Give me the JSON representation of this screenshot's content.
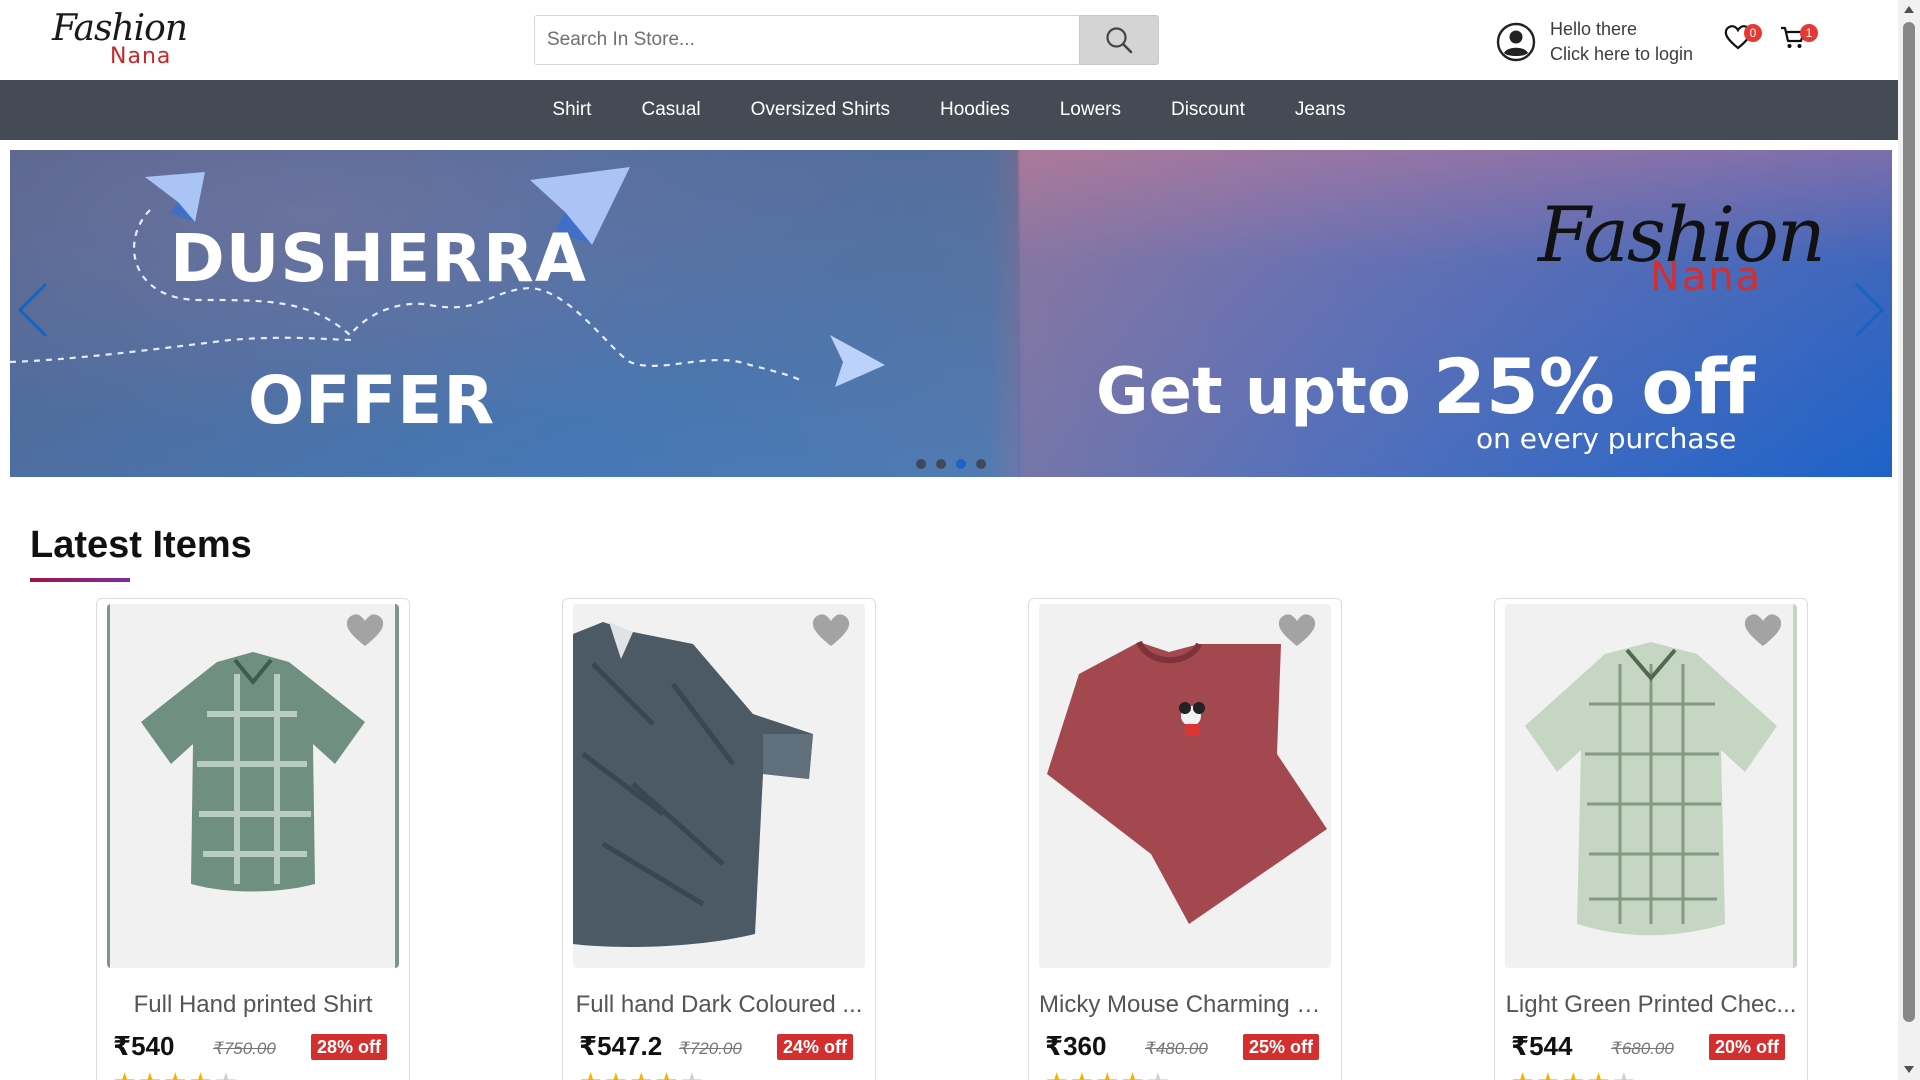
{
  "header": {
    "logo_main": "Fashion",
    "logo_sub": "Nana",
    "search_placeholder": "Search In Store...",
    "greeting": "Hello there",
    "login_prompt": "Click here to login",
    "wishlist_count": "0",
    "cart_count": "1"
  },
  "nav": {
    "items": [
      "Shirt",
      "Casual",
      "Oversized Shirts",
      "Hoodies",
      "Lowers",
      "Discount",
      "Jeans"
    ]
  },
  "banner": {
    "headline_1": "DUSHERRA",
    "headline_2": "OFFER",
    "logo_main": "Fashion",
    "logo_sub": "Nana",
    "offer_prefix": "Get upto",
    "offer_value": "25% off",
    "offer_sub": "on every purchase",
    "slide_count": 4,
    "active_slide": 3
  },
  "section": {
    "title": "Latest Items"
  },
  "products": [
    {
      "name": "Full Hand printed Shirt",
      "price": "₹540",
      "mrp": "₹750.00",
      "discount": "28% off",
      "rating": 4,
      "image_color": "#6f8f80"
    },
    {
      "name": "Full hand Dark Coloured ...",
      "price": "₹547.2",
      "mrp": "₹720.00",
      "discount": "24% off",
      "rating": 4,
      "image_color": "#4c5a66"
    },
    {
      "name": "Micky Mouse Charming C...",
      "price": "₹360",
      "mrp": "₹480.00",
      "discount": "25% off",
      "rating": 4,
      "image_color": "#a4484f"
    },
    {
      "name": "Light Green Printed Chec...",
      "price": "₹544",
      "mrp": "₹680.00",
      "discount": "20% off",
      "rating": 4,
      "image_color": "#c5d6c3"
    }
  ],
  "colors": {
    "nav_bg": "#454b55",
    "badge": "#e53935",
    "discount_badge": "#d32f2f",
    "star": "#f5b300",
    "accent_underline": "#a01347"
  },
  "icons": {
    "search": "search-icon",
    "account": "user-circle-icon",
    "wishlist": "heart-icon",
    "cart": "cart-icon",
    "prev": "chevron-left-icon",
    "next": "chevron-right-icon",
    "favorite": "heart-filled-icon"
  }
}
